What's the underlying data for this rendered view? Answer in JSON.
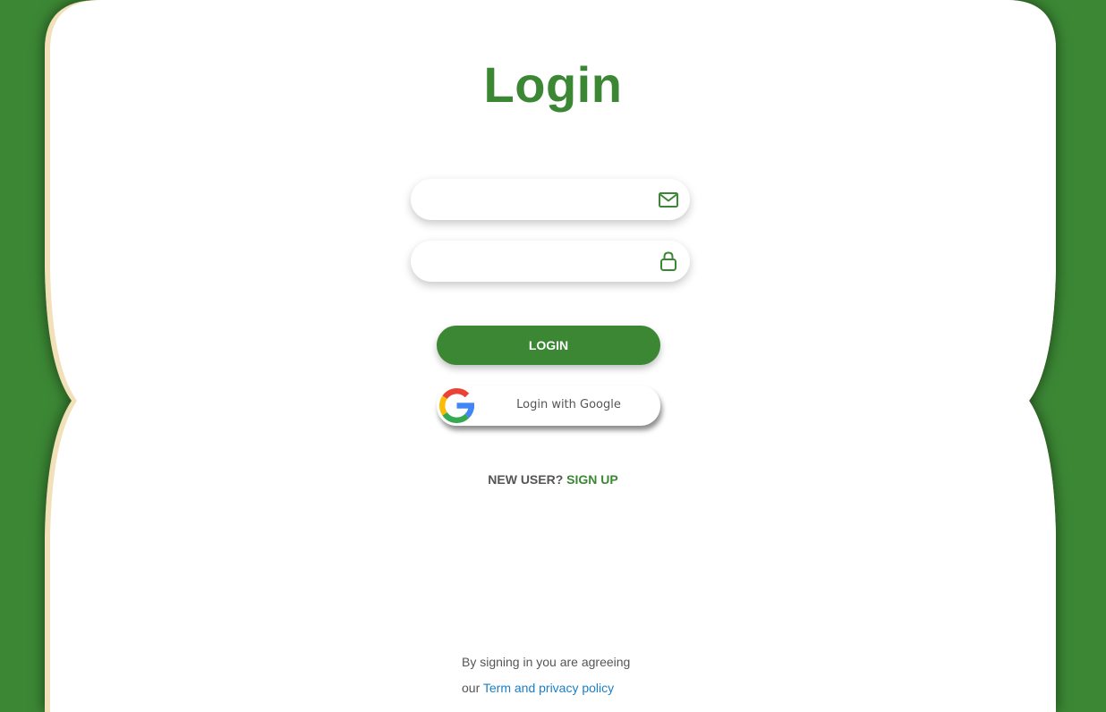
{
  "page": {
    "title": "Login"
  },
  "form": {
    "email": {
      "value": "",
      "placeholder": "",
      "icon": "mail-icon"
    },
    "password": {
      "value": "",
      "placeholder": "",
      "icon": "lock-icon"
    }
  },
  "buttons": {
    "login_label": "LOGIN",
    "google_label": "Login with Google",
    "google_icon": "google-icon"
  },
  "signup": {
    "question": "NEW USER?",
    "link": "SIGN UP"
  },
  "terms": {
    "line1": "By signing in you are agreeing",
    "line2_prefix": "our",
    "link": "Term and privacy policy"
  },
  "colors": {
    "brand_green": "#3b8734",
    "link_blue": "#1a7ec4",
    "card_edge": "#f1e0b8"
  }
}
